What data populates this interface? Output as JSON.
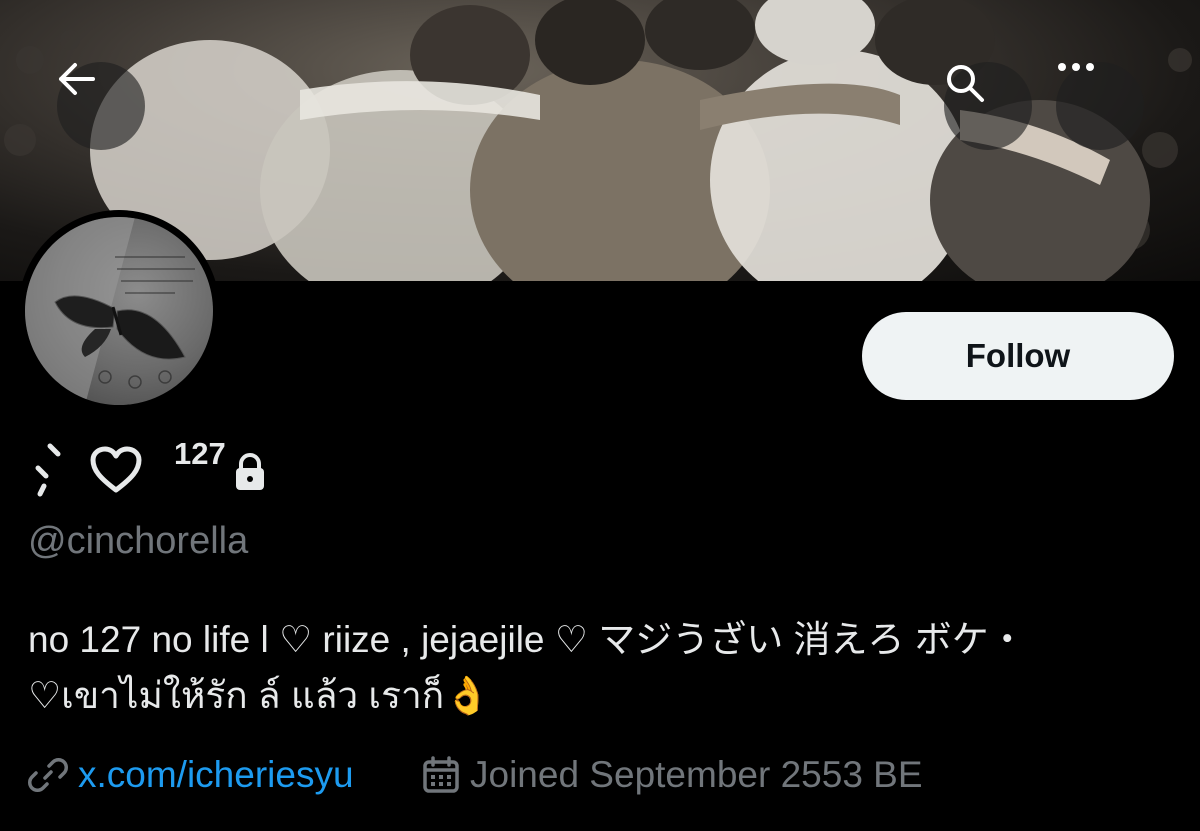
{
  "header": {
    "back_icon": "arrow-left-icon",
    "search_icon": "search-icon",
    "more_icon": "more-horizontal-icon"
  },
  "profile": {
    "display_name_number": "127",
    "display_name_icon": "heart-outline-icon",
    "protected_icon": "lock-icon",
    "handle": "@cinchorella",
    "follow_label": "Follow",
    "bio_line1": "no 127 no life l ♡ riize , jejaejile ♡ マジうざい 消えろ ボケ・",
    "bio_line2": "♡เขาไม่ให้รัก ล์ แล้ว เราก็👌",
    "link_text": "x.com/icheriesyu",
    "joined_text": "Joined September 2553 BE"
  },
  "colors": {
    "background": "#000000",
    "text": "#e7e9ea",
    "muted": "#71767b",
    "link": "#1d9bf0",
    "follow_bg": "#eff3f4",
    "follow_text": "#0f1419"
  }
}
